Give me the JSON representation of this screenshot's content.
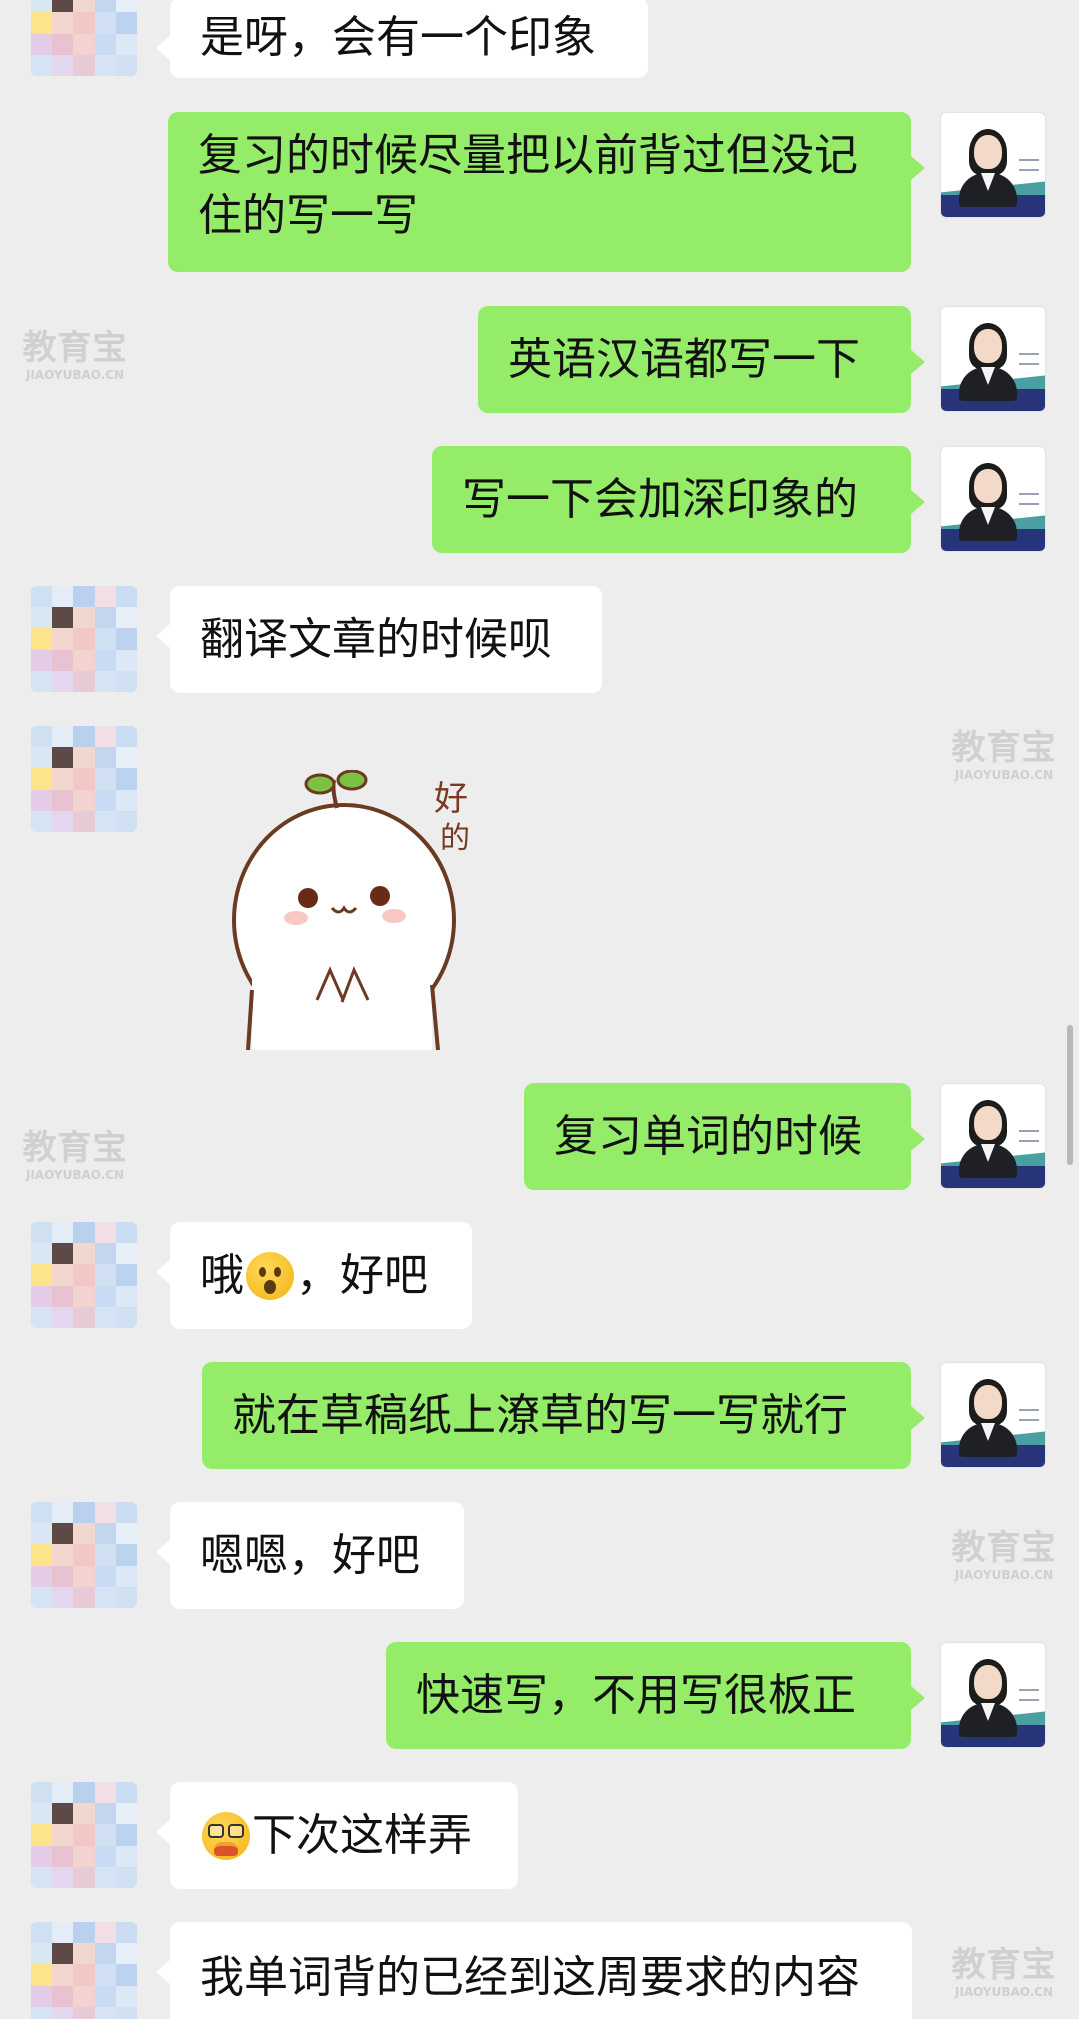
{
  "watermark": {
    "main": "教育宝",
    "sub": "JIAOYUBAO.CN"
  },
  "messages": [
    {
      "side": "in",
      "text": "是呀，会有一个印象"
    },
    {
      "side": "out",
      "lines": [
        "复习的时候尽量把以前背过但没记",
        "住的写一写"
      ]
    },
    {
      "side": "out",
      "text": "英语汉语都写一下"
    },
    {
      "side": "out",
      "text": "写一下会加深印象的"
    },
    {
      "side": "in",
      "text": "翻译文章的时候呗"
    },
    {
      "side": "in",
      "sticker": true,
      "sticker_text": [
        "好",
        "的"
      ]
    },
    {
      "side": "out",
      "text": "复习单词的时候"
    },
    {
      "side": "in",
      "text_before": "哦",
      "emoji": "hushed-face",
      "text_after": "，好吧"
    },
    {
      "side": "out",
      "text": "就在草稿纸上潦草的写一写就行"
    },
    {
      "side": "in",
      "text": "嗯嗯，好吧"
    },
    {
      "side": "out",
      "text": "快速写，不用写很板正"
    },
    {
      "side": "in",
      "emoji": "nerd-burger-face",
      "text_after": "下次这样弄"
    },
    {
      "side": "in",
      "text": "我单词背的已经到这周要求的内容"
    }
  ]
}
